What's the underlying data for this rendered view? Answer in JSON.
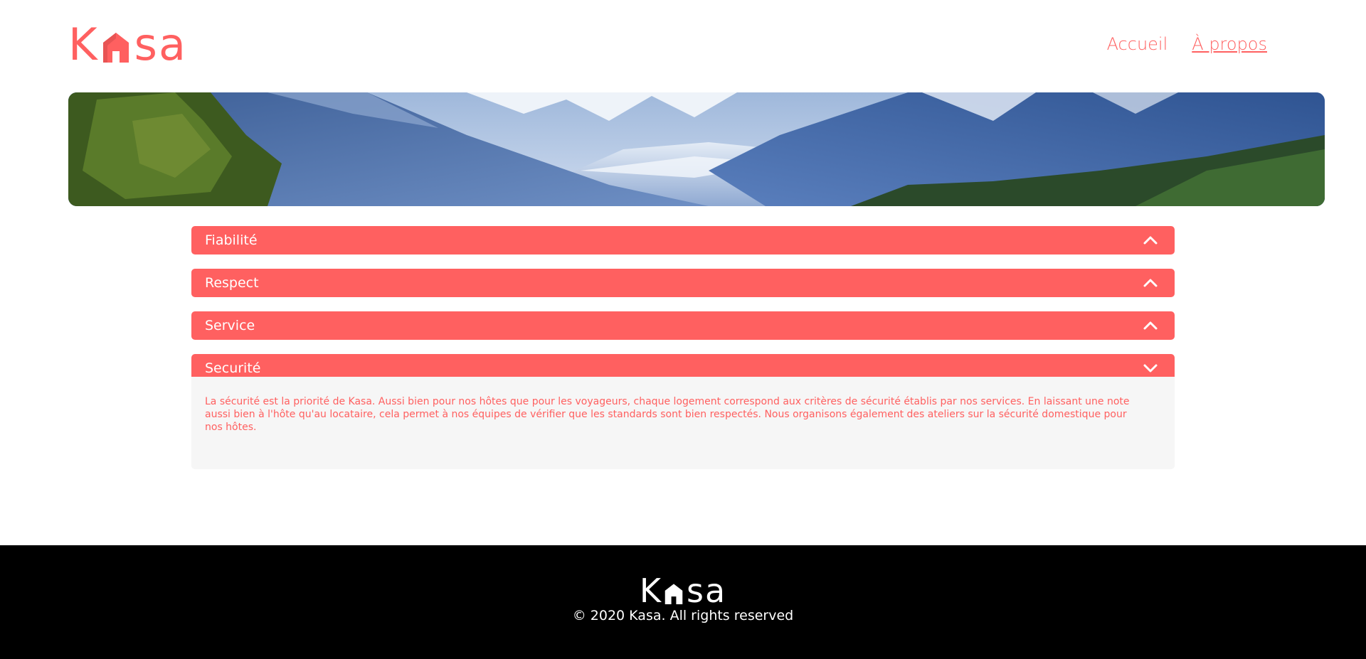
{
  "brand": {
    "logo_text_k": "K",
    "logo_text_sa": "sa",
    "accent_color": "#FF6060"
  },
  "nav": {
    "home_label": "Accueil",
    "about_label": "À propos",
    "active": "about"
  },
  "collapses": [
    {
      "title": "Fiabilité",
      "state": "collapsed",
      "icon": "chevron-up-icon"
    },
    {
      "title": "Respect",
      "state": "collapsed",
      "icon": "chevron-up-icon"
    },
    {
      "title": "Service",
      "state": "collapsed",
      "icon": "chevron-up-icon"
    },
    {
      "title": "Securité",
      "state": "expanded",
      "icon": "chevron-down-icon",
      "content": "La sécurité est la priorité de Kasa. Aussi bien pour nos hôtes que pour les voyageurs, chaque logement correspond aux critères de sécurité établis par nos services. En laissant une note aussi bien à l'hôte qu'au locataire, cela permet à nos équipes de vérifier que les standards sont bien respectés. Nous organisons également des ateliers sur la sécurité domestique pour nos hôtes."
    }
  ],
  "footer": {
    "logo_text_k": "K",
    "logo_text_sa": "sa",
    "copyright": "© 2020 Kasa. All rights reserved"
  }
}
